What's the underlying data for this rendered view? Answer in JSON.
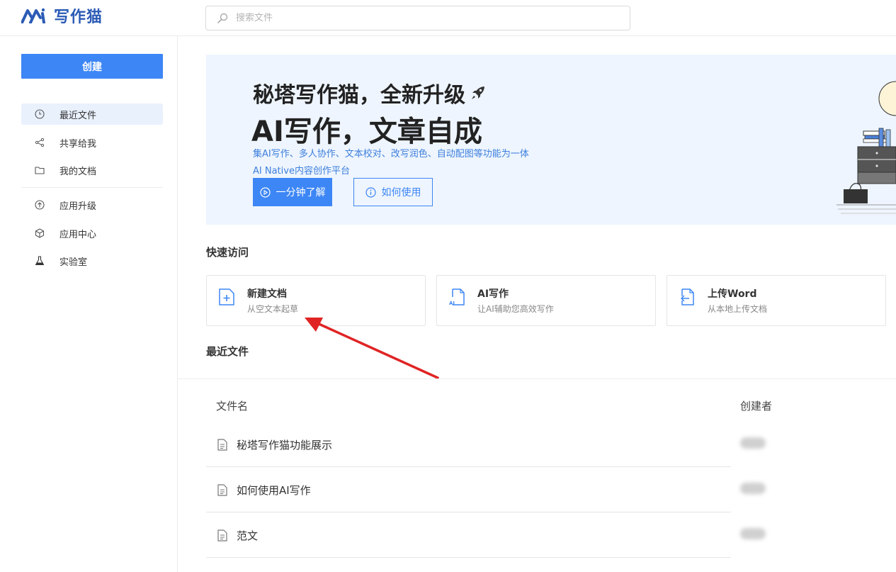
{
  "app": {
    "name": "写作猫",
    "brand_color": "#2b5bb5",
    "accent_color": "#3d86f5"
  },
  "search": {
    "placeholder": "搜索文件"
  },
  "sidebar": {
    "create_label": "创建",
    "items": [
      {
        "label": "最近文件",
        "icon": "clock-icon",
        "active": true
      },
      {
        "label": "共享给我",
        "icon": "share-icon"
      },
      {
        "label": "我的文档",
        "icon": "folder-icon"
      },
      {
        "label": "应用升级",
        "icon": "upgrade-icon"
      },
      {
        "label": "应用中心",
        "icon": "cube-icon"
      },
      {
        "label": "实验室",
        "icon": "flask-icon"
      }
    ]
  },
  "banner": {
    "title_line1": "秘塔写作猫，全新升级",
    "title_line2": "AI写作，文章自成",
    "subtitle1": "集AI写作、多人协作、文本校对、改写润色、自动配图等功能为一体",
    "subtitle2": "AI Native内容创作平台",
    "primary_button": "一分钟了解",
    "secondary_button": "如何使用"
  },
  "quick_access": {
    "title": "快速访问",
    "cards": [
      {
        "title": "新建文档",
        "desc": "从空文本起草",
        "icon": "new-document-icon"
      },
      {
        "title": "AI写作",
        "desc": "让AI辅助您高效写作",
        "icon": "ai-document-icon"
      },
      {
        "title": "上传Word",
        "desc": "从本地上传文档",
        "icon": "upload-document-icon"
      }
    ]
  },
  "recent": {
    "title": "最近文件",
    "columns": [
      "文件名",
      "创建者"
    ],
    "rows": [
      {
        "name": "秘塔写作猫功能展示"
      },
      {
        "name": "如何使用AI写作"
      },
      {
        "name": "范文"
      }
    ]
  }
}
